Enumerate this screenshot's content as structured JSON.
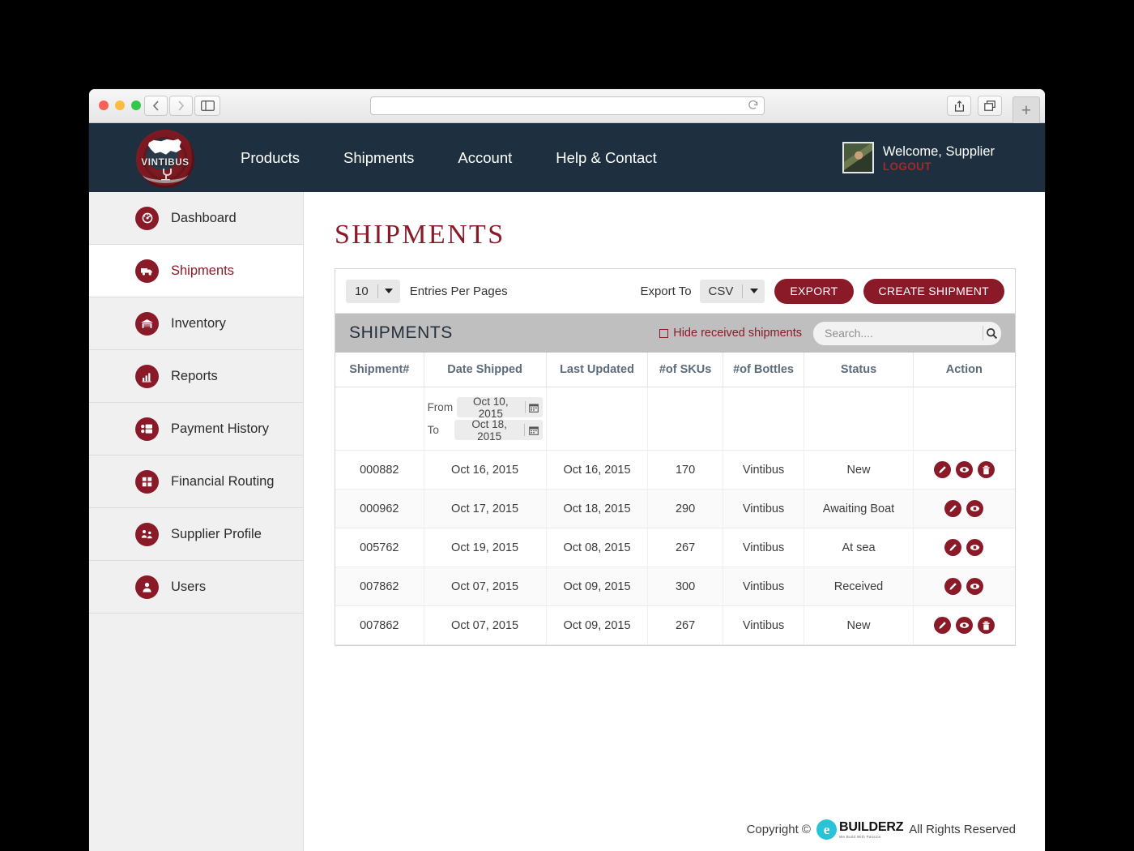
{
  "browser": {
    "url_value": "",
    "back_icon": "back-chevron-icon",
    "forward_icon": "forward-chevron-icon",
    "sidebar_icon": "sidebar-toggle-icon",
    "reload_icon": "reload-icon",
    "share_icon": "share-icon",
    "tabs_icon": "show-tabs-icon",
    "new_tab_label": "+"
  },
  "topnav": {
    "logo_word": "VINTIBUS",
    "links": [
      {
        "label": "Products"
      },
      {
        "label": "Shipments"
      },
      {
        "label": "Account"
      },
      {
        "label": "Help & Contact"
      }
    ],
    "welcome": "Welcome, Supplier",
    "logout": "LOGOUT"
  },
  "sidebar": {
    "items": [
      {
        "label": "Dashboard",
        "icon": "gauge-icon",
        "active": false
      },
      {
        "label": "Shipments",
        "icon": "truck-icon",
        "active": true
      },
      {
        "label": "Inventory",
        "icon": "warehouse-icon",
        "active": false
      },
      {
        "label": "Reports",
        "icon": "bar-chart-icon",
        "active": false
      },
      {
        "label": "Payment History",
        "icon": "cards-icon",
        "active": false
      },
      {
        "label": "Financial Routing",
        "icon": "grid-squares-icon",
        "active": false
      },
      {
        "label": "Supplier Profile",
        "icon": "people-icon",
        "active": false
      },
      {
        "label": "Users",
        "icon": "user-icon",
        "active": false
      }
    ]
  },
  "main": {
    "page_title": "SHIPMENTS",
    "toolbar": {
      "entries_value": "10",
      "entries_label": "Entries Per Pages",
      "export_to_label": "Export To",
      "export_format": "CSV",
      "export_button": "EXPORT",
      "create_button": "CREATE SHIPMENT"
    },
    "panel_header": {
      "title": "SHIPMENTS",
      "hide_received_label": "Hide received shipments",
      "hide_received_checked": false,
      "search_value": "",
      "search_placeholder": "Search....",
      "search_icon": "search-icon"
    },
    "table": {
      "columns": [
        "Shipment#",
        "Date Shipped",
        "Last Updated",
        "#of SKUs",
        "#of Bottles",
        "Status",
        "Action"
      ],
      "filter": {
        "from_label": "From",
        "from_value": "Oct 10, 2015",
        "to_label": "To",
        "to_value": "Oct 18, 2015",
        "calendar_icon": "calendar-icon"
      },
      "rows": [
        {
          "shipment": "000882",
          "date_shipped": "Oct 16, 2015",
          "last_updated": "Oct 16, 2015",
          "skus": "170",
          "bottles": "Vintibus",
          "status": "New",
          "actions": [
            "edit-icon",
            "view-icon",
            "delete-icon"
          ]
        },
        {
          "shipment": "000962",
          "date_shipped": "Oct 17, 2015",
          "last_updated": "Oct 18, 2015",
          "skus": "290",
          "bottles": "Vintibus",
          "status": "Awaiting Boat",
          "actions": [
            "edit-icon",
            "view-icon"
          ]
        },
        {
          "shipment": "005762",
          "date_shipped": "Oct 19, 2015",
          "last_updated": "Oct 08, 2015",
          "skus": "267",
          "bottles": "Vintibus",
          "status": "At sea",
          "actions": [
            "edit-icon",
            "view-icon"
          ]
        },
        {
          "shipment": "007862",
          "date_shipped": "Oct 07, 2015",
          "last_updated": "Oct 09, 2015",
          "skus": "300",
          "bottles": "Vintibus",
          "status": "Received",
          "actions": [
            "edit-icon",
            "view-icon"
          ]
        },
        {
          "shipment": "007862",
          "date_shipped": "Oct 07, 2015",
          "last_updated": "Oct 09, 2015",
          "skus": "267",
          "bottles": "Vintibus",
          "status": "New",
          "actions": [
            "edit-icon",
            "view-icon",
            "delete-icon"
          ]
        }
      ]
    },
    "footer": {
      "copyright_prefix": "Copyright ©",
      "brand_mark": "e",
      "brand_name": "BUILDERZ",
      "brand_tagline": "We Build With Passion",
      "copyright_suffix": "All Rights Reserved"
    }
  },
  "colors": {
    "brand_red": "#8b1a28",
    "nav_navy": "#1e3040",
    "panel_grey": "#bfbfbf",
    "ebuilderz_cyan": "#29c3d8"
  }
}
